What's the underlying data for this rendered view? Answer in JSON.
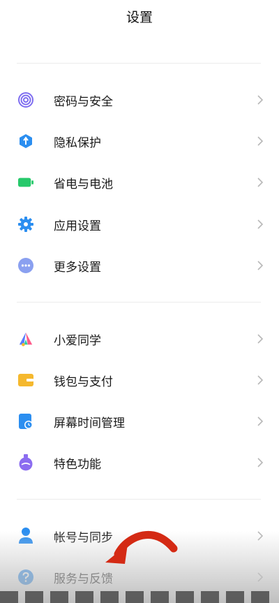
{
  "header": {
    "title": "设置"
  },
  "sections": [
    {
      "items": [
        {
          "label": "密码与安全",
          "icon": "fingerprint-icon",
          "color": "#7e6df0"
        },
        {
          "label": "隐私保护",
          "icon": "privacy-shield-icon",
          "color": "#2b8ef0"
        },
        {
          "label": "省电与电池",
          "icon": "battery-icon",
          "color": "#27c96b"
        },
        {
          "label": "应用设置",
          "icon": "gear-icon",
          "color": "#2b8ef0"
        },
        {
          "label": "更多设置",
          "icon": "more-dots-icon",
          "color": "#8aa0f0"
        }
      ]
    },
    {
      "items": [
        {
          "label": "小爱同学",
          "icon": "xiaoai-icon",
          "color": "#5a7cff"
        },
        {
          "label": "钱包与支付",
          "icon": "wallet-icon",
          "color": "#f5b82e"
        },
        {
          "label": "屏幕时间管理",
          "icon": "screen-time-icon",
          "color": "#2b8ef0"
        },
        {
          "label": "特色功能",
          "icon": "flask-icon",
          "color": "#8b6cf0"
        }
      ]
    },
    {
      "items": [
        {
          "label": "帐号与同步",
          "icon": "account-icon",
          "color": "#2b8ef0"
        },
        {
          "label": "服务与反馈",
          "icon": "help-icon",
          "color": "#2b8ef0"
        }
      ]
    }
  ],
  "overlay": {
    "icon": "red-curved-arrow-icon",
    "color": "#d42a14"
  }
}
